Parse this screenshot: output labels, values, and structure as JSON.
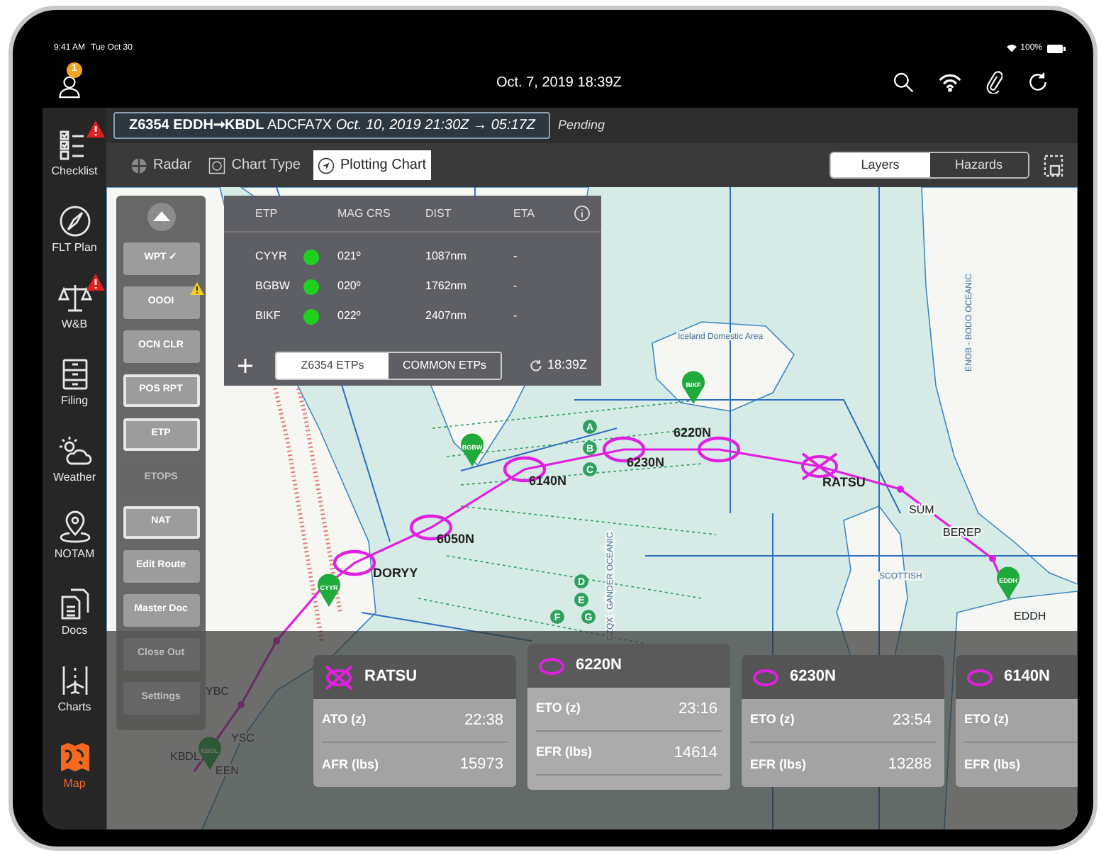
{
  "status_bar": {
    "time": "9:41 AM",
    "date": "Tue Oct 30",
    "battery": "100%"
  },
  "header": {
    "notification_count": "1",
    "datetime": "Oct. 7, 2019 18:39Z"
  },
  "sidebar": {
    "items": [
      {
        "label": "Checklist",
        "kind": "checklist",
        "warning": true,
        "selected": false
      },
      {
        "label": "FLT Plan",
        "kind": "compass",
        "warning": false,
        "selected": false
      },
      {
        "label": "W&B",
        "kind": "scale",
        "warning": true,
        "selected": false
      },
      {
        "label": "Filing",
        "kind": "cabinet",
        "warning": false,
        "selected": false
      },
      {
        "label": "Weather",
        "kind": "weather",
        "warning": false,
        "selected": false
      },
      {
        "label": "NOTAM",
        "kind": "pin",
        "warning": false,
        "selected": false
      },
      {
        "label": "Docs",
        "kind": "docs",
        "warning": false,
        "selected": false
      },
      {
        "label": "Charts",
        "kind": "charts",
        "warning": false,
        "selected": false
      },
      {
        "label": "Map",
        "kind": "map",
        "warning": false,
        "selected": true
      }
    ]
  },
  "flight": {
    "summary": "**Z6354 EDDH➞KBDL** ADCFA7X *Oct. 10, 2019  21:30Z → 05:17Z*",
    "status": "Pending"
  },
  "toolbar": {
    "items": [
      {
        "label": "Radar",
        "kind": "radar",
        "selected": false
      },
      {
        "label": "Chart Type",
        "kind": "chart_type",
        "selected": false
      },
      {
        "label": "Plotting Chart",
        "kind": "plotting",
        "selected": true
      }
    ],
    "segments": [
      {
        "label": "Layers",
        "selected": true
      },
      {
        "label": "Hazards",
        "selected": false
      }
    ]
  },
  "action_panel": {
    "buttons": [
      {
        "label": "WPT ✓",
        "active": false,
        "disabled": false,
        "warning": false
      },
      {
        "label": "OOOI",
        "active": false,
        "disabled": false,
        "warning": true
      },
      {
        "label": "OCN CLR",
        "active": false,
        "disabled": false,
        "warning": false
      },
      {
        "label": "POS RPT",
        "active": true,
        "disabled": false,
        "warning": false
      },
      {
        "label": "ETP",
        "active": true,
        "disabled": false,
        "warning": false
      },
      {
        "label": "ETOPS",
        "active": false,
        "disabled": true,
        "warning": false
      },
      {
        "label": "NAT",
        "active": true,
        "disabled": false,
        "warning": false
      },
      {
        "label": "Edit Route",
        "active": false,
        "disabled": false,
        "warning": false
      },
      {
        "label": "Master Doc",
        "active": false,
        "disabled": false,
        "warning": false
      },
      {
        "label": "Close Out",
        "active": false,
        "disabled": true,
        "warning": false
      },
      {
        "label": "Settings",
        "active": false,
        "disabled": true,
        "warning": false
      }
    ]
  },
  "etp_panel": {
    "columns": [
      "ETP",
      "MAG CRS",
      "DIST",
      "ETA"
    ],
    "rows": [
      {
        "etp": "CYYR",
        "color": "#1fd01f",
        "mag_crs": "021º",
        "dist": "1087nm",
        "eta": "-"
      },
      {
        "etp": "BGBW",
        "color": "#1fd01f",
        "mag_crs": "020º",
        "dist": "1762nm",
        "eta": "-"
      },
      {
        "etp": "BIKF",
        "color": "#1fd01f",
        "mag_crs": "022º",
        "dist": "2407nm",
        "eta": "-"
      }
    ],
    "tabs": [
      {
        "label": "Z6354 ETPs",
        "selected": true
      },
      {
        "label": "COMMON ETPs",
        "selected": false
      }
    ],
    "updated": "18:39Z"
  },
  "map": {
    "pins": [
      "BIKF",
      "BGBW",
      "CYYR",
      "EDDH",
      "KBDL"
    ],
    "waypoints": [
      {
        "name": "DORYY",
        "passed": false
      },
      {
        "name": "6050N",
        "passed": false
      },
      {
        "name": "6140N",
        "passed": false
      },
      {
        "name": "6230N",
        "passed": false
      },
      {
        "name": "6220N",
        "passed": false
      },
      {
        "name": "RATSU",
        "passed": true
      }
    ],
    "labels": [
      "SUM",
      "BEREP",
      "EDDH",
      "YBC",
      "YSC",
      "KBDL",
      "EEN",
      "Iceland Domestic Area",
      "CZQX - GANDER OCEANIC",
      "ENOB - BODO OCEANIC",
      "SCOTTISH"
    ],
    "track_markers": [
      "A",
      "B",
      "C",
      "D",
      "E",
      "F",
      "G"
    ]
  },
  "waypoint_cards": [
    {
      "name": "RATSU",
      "passed": true,
      "selected": false,
      "rows": [
        {
          "label": "ATO (z)",
          "value": "22:38"
        },
        {
          "label": "AFR (lbs)",
          "value": "15973"
        }
      ]
    },
    {
      "name": "6220N",
      "passed": false,
      "selected": true,
      "rows": [
        {
          "label": "ETO (z)",
          "value": "23:16"
        },
        {
          "label": "EFR (lbs)",
          "value": "14614"
        }
      ]
    },
    {
      "name": "6230N",
      "passed": false,
      "selected": false,
      "rows": [
        {
          "label": "ETO (z)",
          "value": "23:54"
        },
        {
          "label": "EFR (lbs)",
          "value": "13288"
        }
      ]
    },
    {
      "name": "6140N",
      "passed": false,
      "selected": false,
      "rows": [
        {
          "label": "ETO (z)"
        },
        {
          "label": "EFR (lbs)"
        }
      ]
    }
  ]
}
